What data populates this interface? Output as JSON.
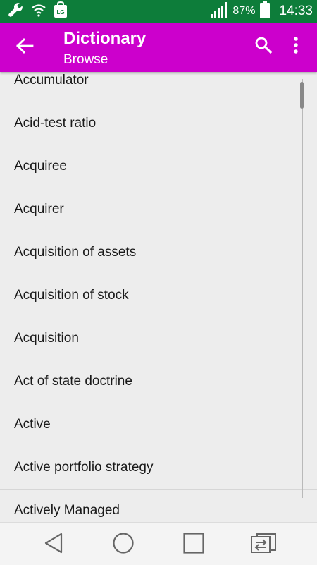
{
  "status_bar": {
    "battery_percent": "87%",
    "time": "14:33",
    "color": "#0d7d3a",
    "icons": [
      "wrench-icon",
      "wifi-icon",
      "lg-app-icon",
      "signal-icon",
      "battery-icon"
    ]
  },
  "app_bar": {
    "title": "Dictionary",
    "subtitle": "Browse",
    "color": "#cc00cc",
    "icons": [
      "back-arrow-icon",
      "search-icon",
      "more-vert-icon"
    ]
  },
  "list": {
    "items": [
      "Accumulator",
      "Acid-test ratio",
      "Acquiree",
      "Acquirer",
      "Acquisition of assets",
      "Acquisition of stock",
      "Acquisition",
      "Act of state doctrine",
      "Active",
      "Active portfolio strategy",
      "Actively Managed"
    ]
  },
  "nav_bar": {
    "icons": [
      "back-triangle-icon",
      "home-circle-icon",
      "recents-square-icon",
      "dual-window-icon"
    ]
  }
}
